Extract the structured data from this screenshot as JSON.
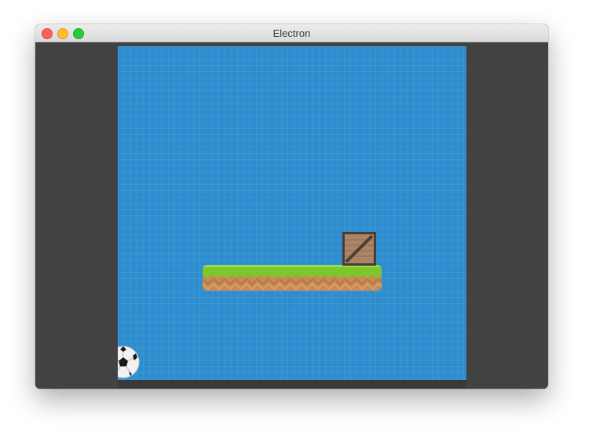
{
  "window": {
    "title": "Electron"
  },
  "game": {
    "background_color": "#2d8dcf",
    "sprites": {
      "platform": "grass-dirt-platform",
      "crate": "wooden-crate",
      "ball": "soccer-ball"
    }
  }
}
